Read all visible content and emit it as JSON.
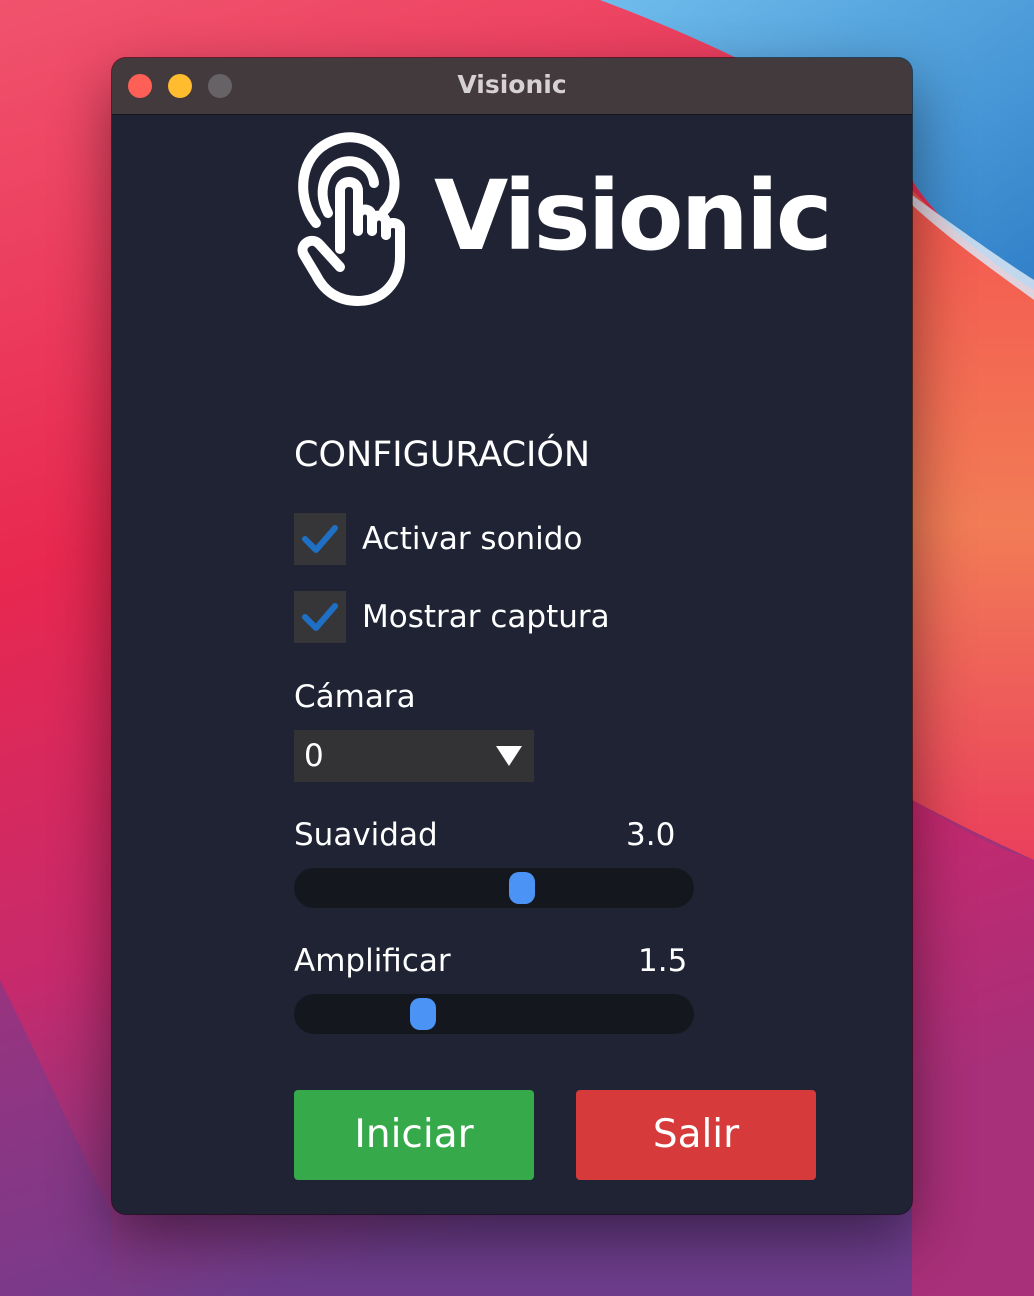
{
  "window": {
    "title": "Visionic"
  },
  "app": {
    "logo_text": "Visionic",
    "logo_icon": "pointing-hand-icon"
  },
  "settings": {
    "heading": "CONFIGURACIÓN",
    "checkboxes": [
      {
        "label": "Activar sonido",
        "checked": true
      },
      {
        "label": "Mostrar captura",
        "checked": true
      }
    ],
    "camera": {
      "label": "Cámara",
      "selected": "0"
    },
    "sliders": [
      {
        "label": "Suavidad",
        "value": "3.0",
        "fraction": 0.58
      },
      {
        "label": "Amplificar",
        "value": "1.5",
        "fraction": 0.3
      }
    ]
  },
  "buttons": {
    "start": "Iniciar",
    "exit": "Salir"
  },
  "colors": {
    "window_bg": "#1f2333",
    "titlebar_bg": "#433a3d",
    "accent_check": "#1f6fc4",
    "slider_thumb": "#4b93f4",
    "start_button": "#36a94b",
    "exit_button": "#d63a3a"
  }
}
